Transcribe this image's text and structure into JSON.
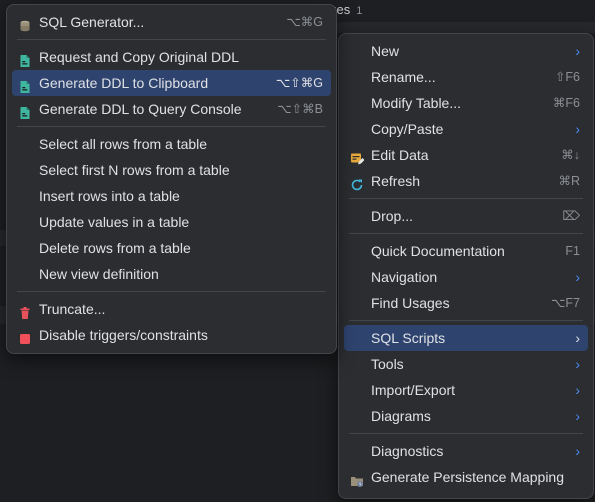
{
  "background": {
    "tab_label": "xes",
    "tab_count": "1"
  },
  "left_menu": {
    "groups": [
      [
        {
          "label": "SQL Generator...",
          "shortcut": "⌥⌘G",
          "icon": "database-stack-icon"
        }
      ],
      [
        {
          "label": "Request and Copy Original DDL",
          "shortcut": "",
          "icon": "ddl-file-icon"
        },
        {
          "label": "Generate DDL to Clipboard",
          "shortcut": "⌥⇧⌘G",
          "icon": "ddl-file-icon",
          "selected": true
        },
        {
          "label": "Generate DDL to Query Console",
          "shortcut": "⌥⇧⌘B",
          "icon": "ddl-file-icon"
        }
      ],
      [
        {
          "label": "Select all rows from a table",
          "shortcut": ""
        },
        {
          "label": "Select first N rows from a table",
          "shortcut": ""
        },
        {
          "label": "Insert rows into a table",
          "shortcut": ""
        },
        {
          "label": "Update values in a table",
          "shortcut": ""
        },
        {
          "label": "Delete rows from a table",
          "shortcut": ""
        },
        {
          "label": "New view definition",
          "shortcut": ""
        }
      ],
      [
        {
          "label": "Truncate...",
          "shortcut": "",
          "icon": "trash-icon"
        },
        {
          "label": "Disable triggers/constraints",
          "shortcut": "",
          "icon": "stop-square-icon"
        }
      ]
    ]
  },
  "right_menu": {
    "groups": [
      [
        {
          "label": "New",
          "submenu": true
        },
        {
          "label": "Rename...",
          "shortcut": "⇧F6"
        },
        {
          "label": "Modify Table...",
          "shortcut": "⌘F6"
        },
        {
          "label": "Copy/Paste",
          "submenu": true
        },
        {
          "label": "Edit Data",
          "shortcut": "⌘↓",
          "icon": "edit-data-icon"
        },
        {
          "label": "Refresh",
          "shortcut": "⌘R",
          "icon": "refresh-icon"
        }
      ],
      [
        {
          "label": "Drop...",
          "shortcut": "⌦"
        }
      ],
      [
        {
          "label": "Quick Documentation",
          "shortcut": "F1"
        },
        {
          "label": "Navigation",
          "submenu": true
        },
        {
          "label": "Find Usages",
          "shortcut": "⌥F7"
        }
      ],
      [
        {
          "label": "SQL Scripts",
          "submenu": true,
          "selected": true
        },
        {
          "label": "Tools",
          "submenu": true
        },
        {
          "label": "Import/Export",
          "submenu": true
        },
        {
          "label": "Diagrams",
          "submenu": true
        }
      ],
      [
        {
          "label": "Diagnostics",
          "submenu": true
        },
        {
          "label": "Generate Persistence Mapping",
          "shortcut": "",
          "icon": "persistence-mapping-icon"
        }
      ]
    ]
  },
  "colors": {
    "menu_bg": "#2b2d30",
    "selection": "#2e436e",
    "chevron": "#4c8cf5",
    "ddl_icon": "#3fb6a0",
    "trash_icon": "#e8535b",
    "stop_icon": "#f0505a",
    "edit_data_icon": "#e8a93c",
    "refresh_icon": "#3fb6d8"
  }
}
